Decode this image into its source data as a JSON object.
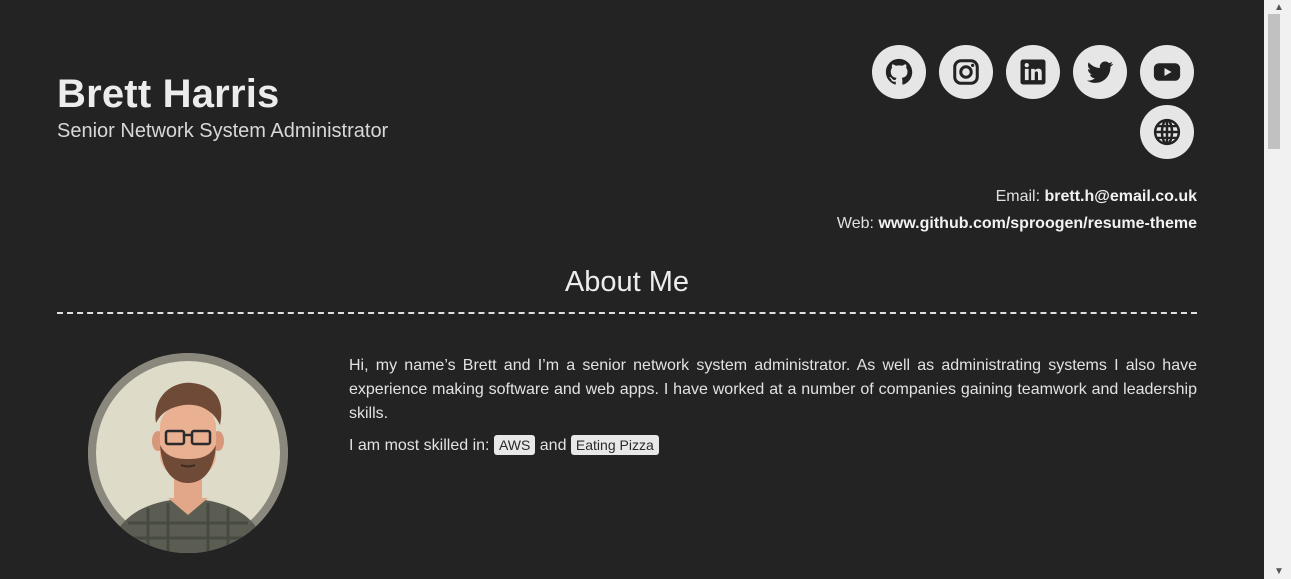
{
  "header": {
    "name": "Brett Harris",
    "role": "Senior Network System Administrator"
  },
  "socials": [
    {
      "icon": "github-icon"
    },
    {
      "icon": "instagram-icon"
    },
    {
      "icon": "linkedin-icon"
    },
    {
      "icon": "twitter-icon"
    },
    {
      "icon": "youtube-icon"
    },
    {
      "icon": "globe-icon"
    }
  ],
  "contact": {
    "email_label": "Email:",
    "email": "brett.h@email.co.uk",
    "web_label": "Web:",
    "web": "www.github.com/sproogen/resume-theme"
  },
  "about": {
    "title": "About Me",
    "paragraph": "Hi, my name’s Brett and I’m a senior network system administrator. As well as administrating systems I also have experience making software and web apps. I have worked at a number of companies gaining teamwork and leadership skills.",
    "skills_prefix": "I am most skilled in:",
    "skills": [
      "AWS",
      "Eating Pizza"
    ],
    "skills_joiner": "and"
  },
  "colors": {
    "background": "#232323",
    "text": "#e6e6e6",
    "icon_circle": "#e6e6e6",
    "tag_bg": "#e8e8e8"
  }
}
